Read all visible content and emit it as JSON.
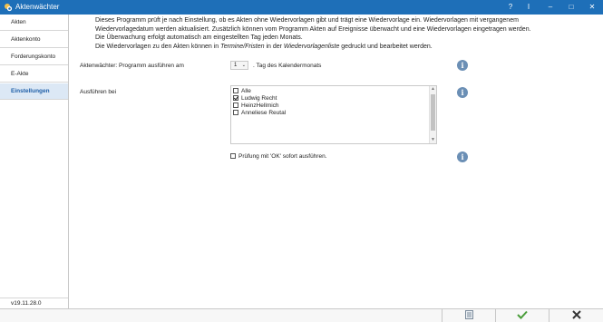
{
  "window": {
    "title": "Aktenwächter",
    "controls": [
      "?",
      "I",
      "–",
      "□",
      "✕"
    ]
  },
  "sidebar": {
    "items": [
      {
        "label": "Akten",
        "active": false
      },
      {
        "label": "Aktenkonto",
        "active": false
      },
      {
        "label": "Forderungskonto",
        "active": false
      },
      {
        "label": "E-Akte",
        "active": false
      },
      {
        "label": "Einstellungen",
        "active": true
      }
    ],
    "version": "v19.11.28.0"
  },
  "intro": {
    "line1": "Dieses Programm prüft je nach Einstellung, ob es Akten ohne Wiedervorlagen gibt und trägt eine Wiedervorlage ein. Wiedervorlagen mit vergangenem",
    "line2": "Wiedervorlagedatum werden aktualisiert. Zusätzlich können vom Programm Akten auf Ereignisse überwacht und eine Wiedervorlagen eingetragen werden.",
    "line3": "Die Überwachung erfolgt automatisch am eingestellten Tag jeden Monats.",
    "line4_pre": "Die Wiedervorlagen zu den Akten können in ",
    "line4_em1": "Termine/Fristen",
    "line4_mid": " in der ",
    "line4_em2": "Wiedervorlagenliste",
    "line4_post": " gedruckt und bearbeitet werden."
  },
  "schedule": {
    "label": "Aktenwächter: Programm ausführen am",
    "day_value": "1",
    "suffix": ". Tag des Kalendermonats"
  },
  "execute_for": {
    "label": "Ausführen bei",
    "options": [
      {
        "label": "Alle",
        "checked": false
      },
      {
        "label": "Ludwig Recht",
        "checked": true
      },
      {
        "label": "HeinzHellmich",
        "checked": false
      },
      {
        "label": "Anneliese Reutal",
        "checked": false
      }
    ]
  },
  "immediate": {
    "label": "Prüfung mit 'OK' sofort ausführen.",
    "checked": false
  },
  "footer": {
    "buttons": [
      "list-icon",
      "ok-check-icon",
      "cancel-x-icon"
    ]
  },
  "colors": {
    "titlebar": "#1e6fb8",
    "active_nav": "#dce8f5",
    "info_icon": "#6b8fb5",
    "ok_green": "#4a9d3a"
  }
}
